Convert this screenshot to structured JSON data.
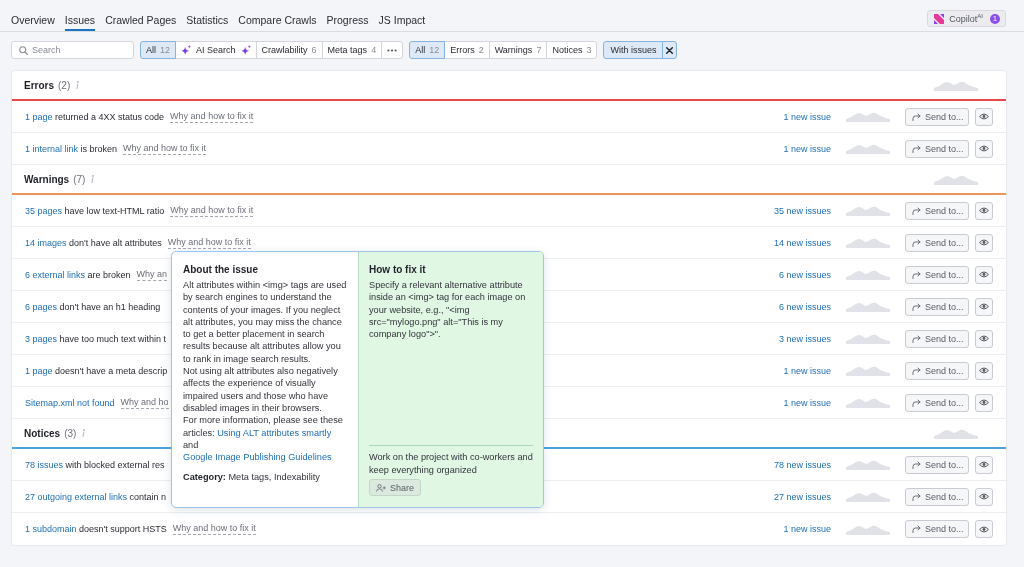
{
  "nav_tabs": [
    {
      "label": "Overview",
      "selected": false
    },
    {
      "label": "Issues",
      "selected": true
    },
    {
      "label": "Crawled Pages",
      "selected": false
    },
    {
      "label": "Statistics",
      "selected": false
    },
    {
      "label": "Compare Crawls",
      "selected": false
    },
    {
      "label": "Progress",
      "selected": false
    },
    {
      "label": "JS Impact",
      "selected": false
    }
  ],
  "copilot": {
    "label": "Copilot$^{AI}$",
    "badge": "1"
  },
  "search": {
    "placeholder": "Search"
  },
  "category_filters": [
    {
      "kind": "count",
      "label": "All",
      "count": "12",
      "selected": true
    },
    {
      "kind": "ai",
      "label": "AI Search",
      "selected": false
    },
    {
      "kind": "count",
      "label": "Crawlability",
      "count": "6",
      "selected": false
    },
    {
      "kind": "count",
      "label": "Meta tags",
      "count": "4",
      "selected": false
    },
    {
      "kind": "more",
      "selected": false
    }
  ],
  "severity_filters": [
    {
      "label": "All",
      "count": "12",
      "selected": true
    },
    {
      "label": "Errors",
      "count": "2",
      "selected": false
    },
    {
      "label": "Warnings",
      "count": "7",
      "selected": false
    },
    {
      "label": "Notices",
      "count": "3",
      "selected": false
    }
  ],
  "active_filter": {
    "label": "With issues"
  },
  "sections": [
    {
      "title": "Errors",
      "count": "(2)",
      "color": "#e5484d",
      "issues": [
        {
          "link": "1 page",
          "text": "returned a 4XX status code",
          "help": "Why and how to fix it",
          "new_issues": "1 new issue",
          "send_label": "Send to..."
        },
        {
          "link": "1 internal link",
          "text": "is broken",
          "help": "Why and how to fix it",
          "new_issues": "1 new issue",
          "send_label": "Send to..."
        }
      ]
    },
    {
      "title": "Warnings",
      "count": "(7)",
      "color": "#f0955a",
      "issues": [
        {
          "link": "35 pages",
          "text": "have low text-HTML ratio",
          "help": "Why and how to fix it",
          "new_issues": "35 new issues",
          "send_label": "Send to..."
        },
        {
          "link": "14 images",
          "text": "don't have alt attributes",
          "help": "Why and how to fix it",
          "new_issues": "14 new issues",
          "send_label": "Send to..."
        },
        {
          "link": "6 external links",
          "text": "are broken",
          "help": "Why an",
          "new_issues": "6 new issues",
          "send_label": "Send to..."
        },
        {
          "link": "6 pages",
          "text": "don't have an h1 heading",
          "new_issues": "6 new issues",
          "send_label": "Send to..."
        },
        {
          "link": "3 pages",
          "text": "have too much text within t",
          "new_issues": "3 new issues",
          "send_label": "Send to..."
        },
        {
          "link": "1 page",
          "text": "doesn't have a meta descrip",
          "new_issues": "1 new issue",
          "send_label": "Send to..."
        },
        {
          "link": "Sitemap.xml not found",
          "help": "Why and ho",
          "new_issues": "1 new issue",
          "send_label": "Send to..."
        }
      ]
    },
    {
      "title": "Notices",
      "count": "(3)",
      "color": "#4aa3df",
      "issues": [
        {
          "link": "78 issues",
          "text": "with blocked external res",
          "new_issues": "78 new issues",
          "send_label": "Send to..."
        },
        {
          "link": "27 outgoing external links",
          "text": "contain n",
          "new_issues": "27 new issues",
          "send_label": "Send to..."
        },
        {
          "link": "1 subdomain",
          "text": "doesn't support HSTS",
          "help": "Why and how to fix it",
          "new_issues": "1 new issue",
          "send_label": "Send to..."
        }
      ]
    }
  ],
  "popup": {
    "about_title": "About the issue",
    "about_paragraphs": [
      "Alt attributes within <img> tags are used by search engines to understand the contents of your images. If you neglect alt attributes, you may miss the chance to get a better placement in search results because alt attributes allow you to rank in image search results.",
      "Not using alt attributes also negatively affects the experience of visually impaired users and those who have disabled images in their browsers."
    ],
    "more_info": [
      {
        "kind": "text",
        "text": "For more information, please see these articles:"
      },
      {
        "kind": "link",
        "text": "Using ALT attributes smartly"
      },
      {
        "kind": "text",
        "text": "and"
      },
      {
        "kind": "link",
        "text": "Google Image Publishing Guidelines"
      }
    ],
    "category": "**Category:** Meta tags, Indexability",
    "fix_title": "How to fix it",
    "fix_text": "Specify a relevant alternative attribute inside an <img> tag for each image on your website, e.g., \"<img src=\"mylogo.png\" alt=\"This is my company logo\">\".",
    "share_text": "Work on the project with co-workers and keep everything organized",
    "share_button": "Share"
  }
}
